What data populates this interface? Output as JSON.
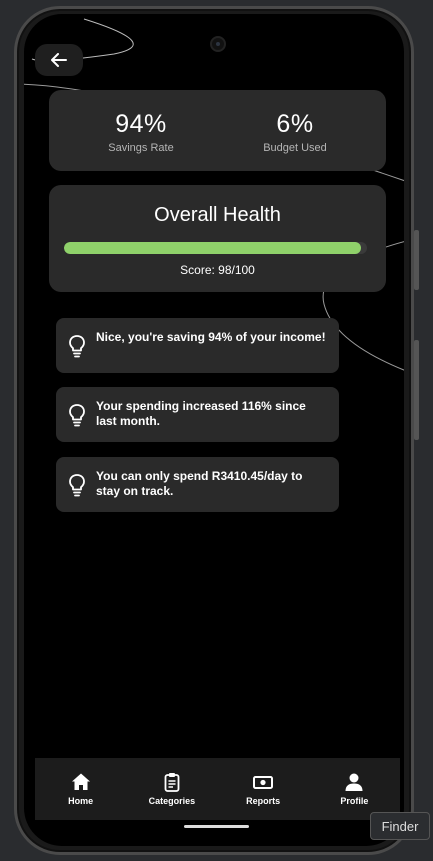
{
  "stats": {
    "savings_rate_value": "94%",
    "savings_rate_label": "Savings Rate",
    "budget_used_value": "6%",
    "budget_used_label": "Budget Used"
  },
  "health": {
    "title": "Overall Health",
    "score_text": "Score: 98/100",
    "score_fraction": 0.98,
    "bar_color": "#8fd16a"
  },
  "tips": [
    {
      "icon": "lightbulb-icon",
      "text": "Nice, you're saving 94% of your income!"
    },
    {
      "icon": "lightbulb-icon",
      "text": "Your spending increased 116% since last month."
    },
    {
      "icon": "lightbulb-icon",
      "text": "You can only spend R3410.45/day to stay on track."
    }
  ],
  "nav": {
    "items": [
      {
        "label": "Home",
        "icon": "home-icon"
      },
      {
        "label": "Categories",
        "icon": "clipboard-icon"
      },
      {
        "label": "Reports",
        "icon": "money-icon"
      },
      {
        "label": "Profile",
        "icon": "person-icon"
      }
    ]
  },
  "tooltip": {
    "label": "Finder"
  },
  "back_button": {
    "icon": "arrow-left-icon"
  }
}
